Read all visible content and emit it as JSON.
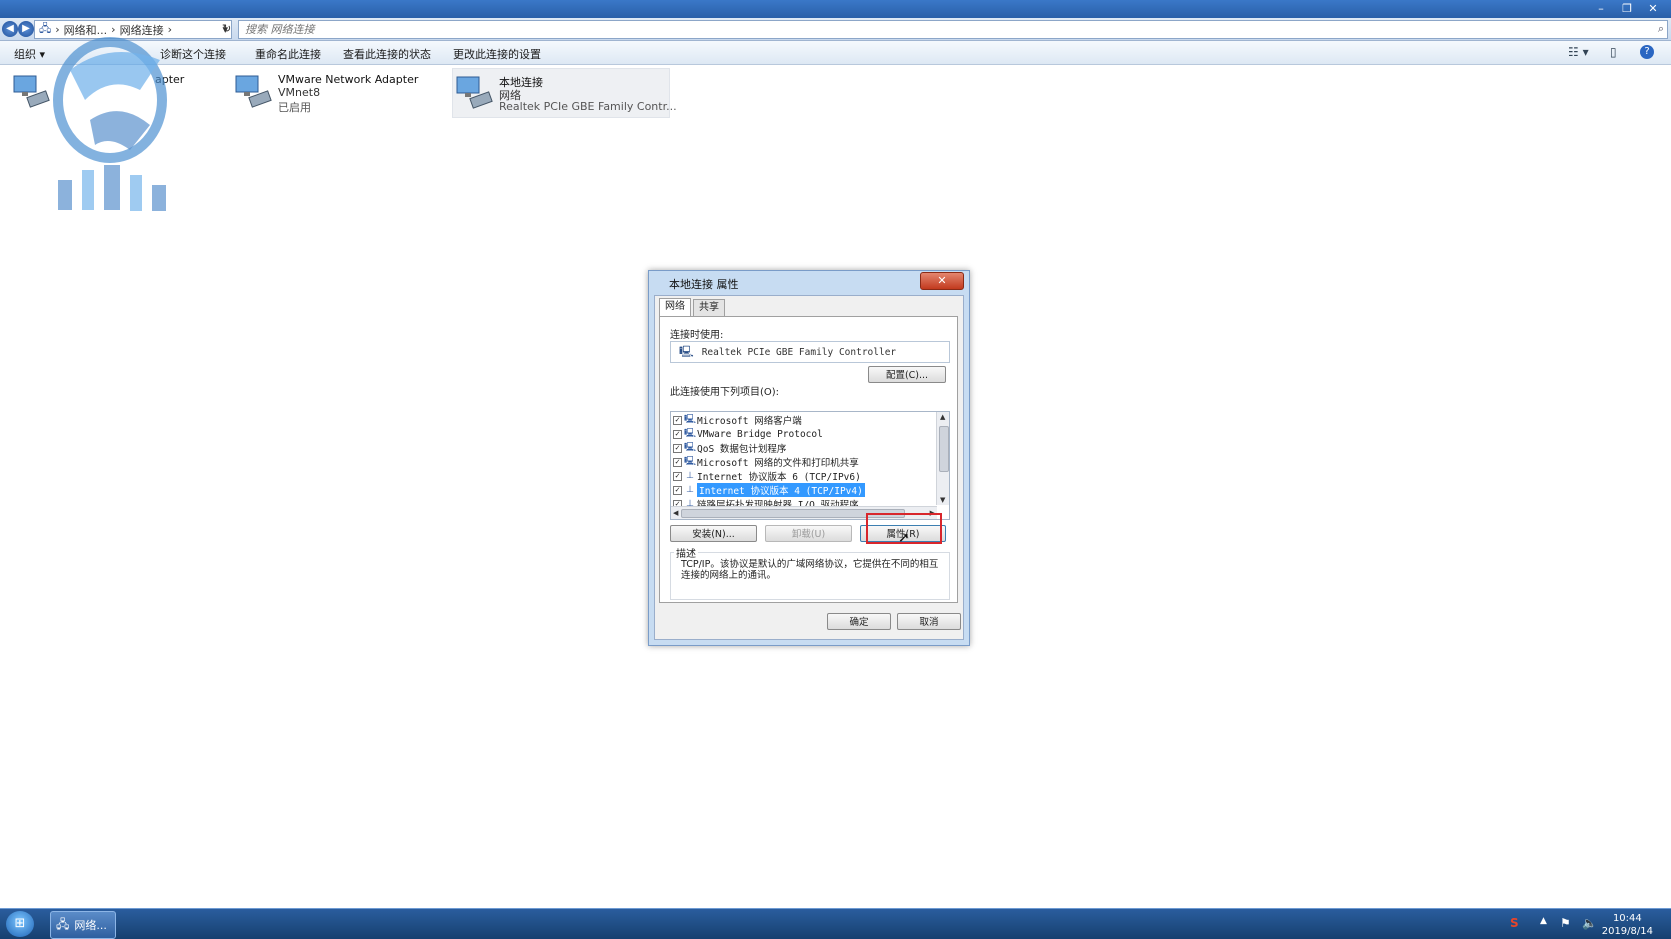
{
  "window": {
    "controls": [
      "–",
      "❐",
      "✕"
    ]
  },
  "address": {
    "crumbs": [
      "网络和...",
      "网络连接"
    ],
    "search_placeholder": "搜索 网络连接"
  },
  "commands": {
    "organize": "组织",
    "diagnose": "诊断这个连接",
    "rename": "重命名此连接",
    "view_status": "查看此连接的状态",
    "change_settings": "更改此连接的设置"
  },
  "adapters": [
    {
      "name": "apter",
      "line2": "",
      "line3": ""
    },
    {
      "name": "VMware Network Adapter",
      "line2": "VMnet8",
      "line3": "已启用"
    },
    {
      "name": "本地连接",
      "line2": "网络",
      "line3": "Realtek PCIe GBE Family Contr..."
    }
  ],
  "dialog": {
    "title": "本地连接 属性",
    "close": "✕",
    "tabs": [
      "网络",
      "共享"
    ],
    "connect_using_label": "连接时使用:",
    "adapter": "Realtek PCIe GBE Family Controller",
    "configure_button": "配置(C)...",
    "items_label": "此连接使用下列项目(O):",
    "components": [
      {
        "label": "Microsoft 网络客户端",
        "checked": true,
        "selected": false
      },
      {
        "label": "VMware Bridge Protocol",
        "checked": true,
        "selected": false
      },
      {
        "label": "QoS 数据包计划程序",
        "checked": true,
        "selected": false
      },
      {
        "label": "Microsoft 网络的文件和打印机共享",
        "checked": true,
        "selected": false
      },
      {
        "label": "Internet 协议版本 6 (TCP/IPv6)",
        "checked": true,
        "selected": false
      },
      {
        "label": "Internet 协议版本 4 (TCP/IPv4)",
        "checked": true,
        "selected": true
      },
      {
        "label": "链路层拓扑发现映射器 I/O 驱动程序",
        "checked": true,
        "selected": false
      }
    ],
    "install_button": "安装(N)...",
    "uninstall_button": "卸载(U)",
    "properties_button": "属性(R)",
    "description_label": "描述",
    "description": "TCP/IP。该协议是默认的广域网络协议，它提供在不同的相互连接的网络上的通讯。",
    "ok_button": "确定",
    "cancel_button": "取消"
  },
  "taskbar": {
    "task_label": "网络...",
    "time": "10:44",
    "date": "2019/8/14"
  },
  "colors": {
    "titlebar": "#2a5fa8",
    "selection": "#3399ff",
    "highlight_box": "#d8262c",
    "taskbar": "#16406f"
  }
}
